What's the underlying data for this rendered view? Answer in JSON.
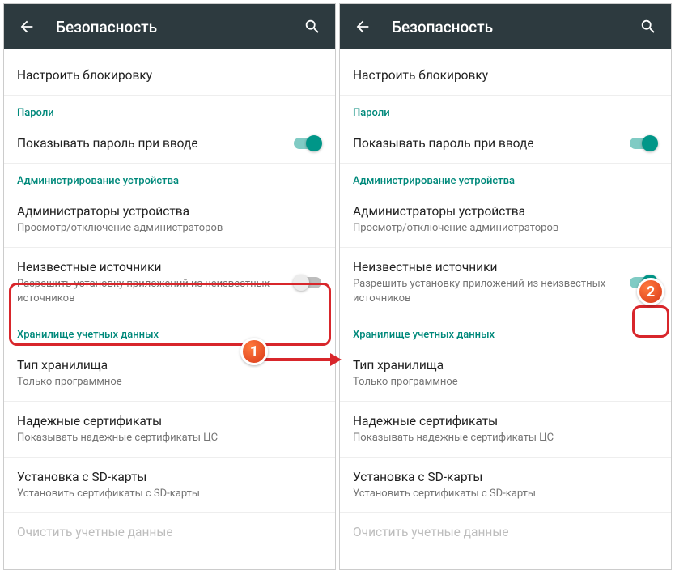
{
  "appbar": {
    "title": "Безопасность"
  },
  "rows": {
    "configure_lock": "Настроить блокировку",
    "section_passwords": "Пароли",
    "show_password": "Показывать пароль при вводе",
    "section_admin": "Администрирование устройства",
    "device_admins_title": "Администраторы устройства",
    "device_admins_sub": "Просмотр/отключение администраторов",
    "unknown_sources_title": "Неизвестные источники",
    "unknown_sources_sub": "Разрешить установку приложений из неизвестных источников",
    "section_credentials": "Хранилище учетных данных",
    "storage_type_title": "Тип хранилища",
    "storage_type_sub": "Только программное",
    "trusted_certs_title": "Надежные сертификаты",
    "trusted_certs_sub": "Показывать надежные сертификаты ЦС",
    "sd_install_title": "Установка с SD-карты",
    "sd_install_sub": "Установить сертификаты с SD-карты",
    "clear_creds": "Очистить учетные данные"
  },
  "badges": {
    "one": "1",
    "two": "2"
  }
}
